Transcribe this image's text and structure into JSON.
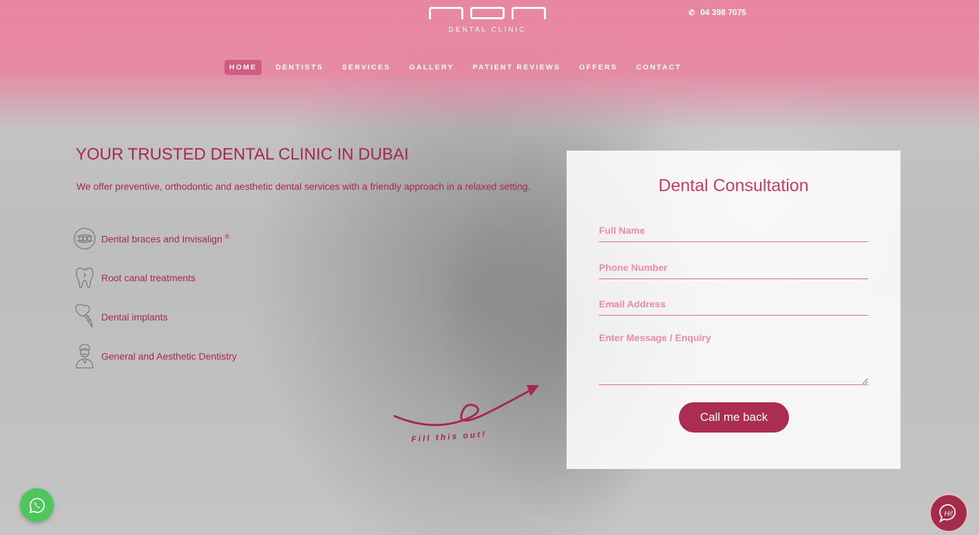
{
  "header": {
    "logo_text": "NOA",
    "logo_subtitle": "DENTAL CLINIC",
    "phone_icon": "phone-icon",
    "phone": "04 398 7075"
  },
  "nav": {
    "items": [
      {
        "label": "HOME",
        "active": true
      },
      {
        "label": "DENTISTS"
      },
      {
        "label": "SERVICES"
      },
      {
        "label": "GALLERY"
      },
      {
        "label": "PATIENT REVIEWS"
      },
      {
        "label": "OFFERS"
      },
      {
        "label": "CONTACT"
      }
    ]
  },
  "hero": {
    "headline": "YOUR TRUSTED DENTAL CLINIC IN DUBAI",
    "intro": "We offer preventive, orthodontic and aesthetic dental services with a friendly approach in a relaxed setting.",
    "features": [
      {
        "icon": "braces-icon",
        "label": "Dental braces and Invisalign",
        "sup": "®"
      },
      {
        "icon": "tooth-icon",
        "label": "Root canal treatments"
      },
      {
        "icon": "implant-icon",
        "label": "Dental implants"
      },
      {
        "icon": "dentist-icon",
        "label": "General and Aesthetic Dentistry"
      }
    ],
    "arrow_text": "Fill this out!"
  },
  "form": {
    "title": "Dental Consultation",
    "name_placeholder": "Full Name",
    "phone_placeholder": "Phone Number",
    "email_placeholder": "Email Address",
    "message_placeholder": "Enter Message / Enquiry",
    "submit_label": "Call me back"
  },
  "widgets": {
    "whatsapp_icon": "whatsapp-icon",
    "chat_icon": "chat-hi-icon",
    "chat_text": "Hi!"
  },
  "colors": {
    "brand_pink": "#ec80a0",
    "brand_dark": "#a5284d",
    "button": "#ab2e52",
    "whatsapp": "#4dc65c"
  }
}
